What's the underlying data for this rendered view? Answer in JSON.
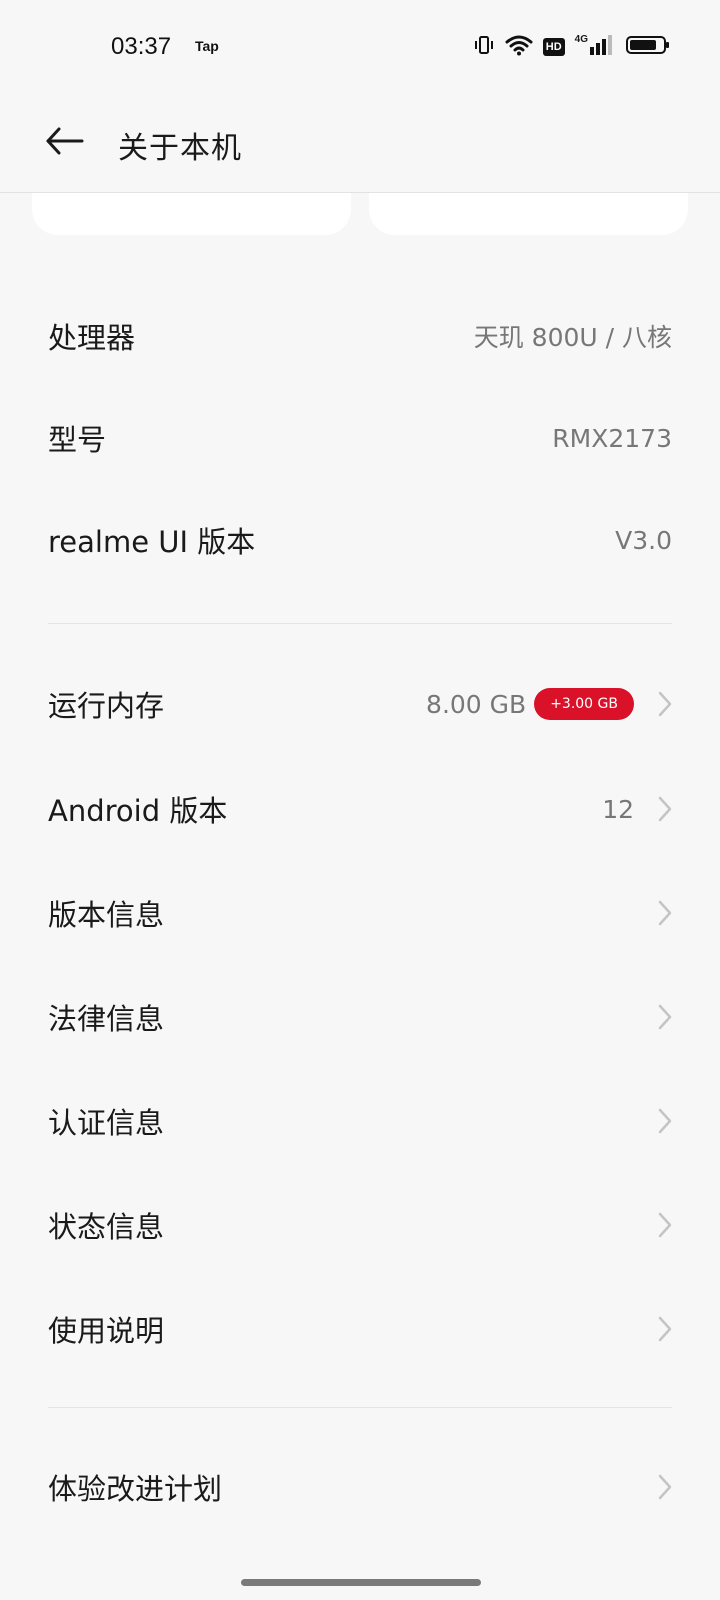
{
  "status_bar": {
    "time": "03:37",
    "app_label": "Tap",
    "hd": "HD",
    "network": "4G"
  },
  "header": {
    "title": "关于本机"
  },
  "spec_rows": [
    {
      "label": "处理器",
      "value": "天玑 800U / 八核"
    },
    {
      "label": "型号",
      "value": "RMX2173"
    },
    {
      "label": "realme UI 版本",
      "value": "V3.0"
    }
  ],
  "ram_row": {
    "label": "运行内存",
    "value": "8.00 GB",
    "badge": "+3.00 GB"
  },
  "info_rows": [
    {
      "label": "Android 版本",
      "value": "12"
    },
    {
      "label": "版本信息",
      "value": ""
    },
    {
      "label": "法律信息",
      "value": ""
    },
    {
      "label": "认证信息",
      "value": ""
    },
    {
      "label": "状态信息",
      "value": ""
    },
    {
      "label": "使用说明",
      "value": ""
    }
  ],
  "extra_rows": [
    {
      "label": "体验改进计划",
      "value": ""
    }
  ],
  "colors": {
    "background": "#f7f7f7",
    "badge": "#d91129",
    "value_text": "#777777"
  }
}
